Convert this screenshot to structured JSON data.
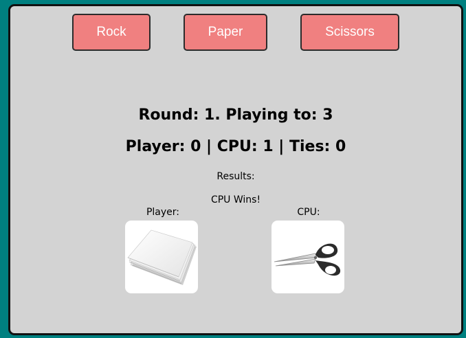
{
  "buttons": {
    "rock": "Rock",
    "paper": "Paper",
    "scissors": "Scissors"
  },
  "status": {
    "round": "Round: 1. Playing to: 3",
    "score": "Player: 0 | CPU: 1 | Ties: 0",
    "results_label": "Results:",
    "results_text": "CPU Wins!"
  },
  "picks": {
    "player_label": "Player:",
    "cpu_label": "CPU:",
    "player_choice_icon": "paper-stack-icon",
    "cpu_choice_icon": "scissors-icon"
  },
  "colors": {
    "background": "#008080",
    "panel": "#d3d3d3",
    "button": "#f08080",
    "button_text": "#ffffff"
  }
}
